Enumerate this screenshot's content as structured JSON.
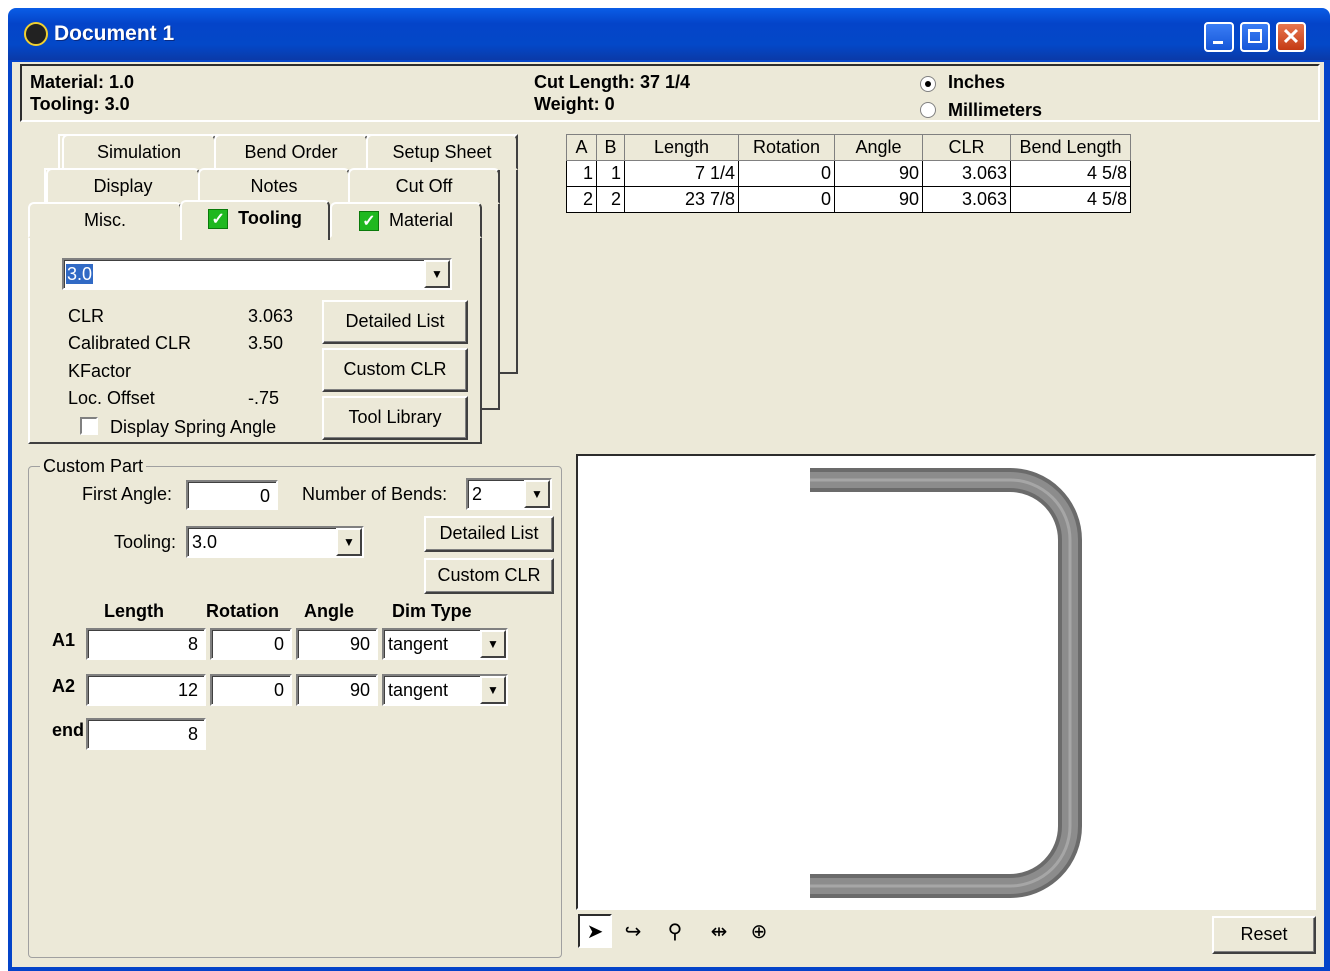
{
  "window": {
    "title": "Document 1"
  },
  "header": {
    "material": "Material: 1.0",
    "tooling": "Tooling: 3.0",
    "cut_length": "Cut Length: 37  1/4",
    "weight": "Weight: 0",
    "units": [
      {
        "label": "Inches",
        "selected": true
      },
      {
        "label": "Millimeters",
        "selected": false
      }
    ]
  },
  "tabs": {
    "row1": [
      "Simulation",
      "Bend Order",
      "Setup Sheet"
    ],
    "row2": [
      "Display",
      "Notes",
      "Cut Off"
    ],
    "row3": [
      "Misc.",
      "Tooling",
      "Material"
    ],
    "active": "Tooling"
  },
  "tooling_panel": {
    "select_value": "3.0",
    "clr_label": "CLR",
    "clr_value": "3.063",
    "cal_clr_label": "Calibrated CLR",
    "cal_clr_value": "3.50",
    "kfactor_label": "KFactor",
    "kfactor_value": "",
    "loc_offset_label": "Loc. Offset",
    "loc_offset_value": "-.75",
    "spring_label": "Display Spring Angle",
    "btn_detailed": "Detailed List",
    "btn_custom": "Custom CLR",
    "btn_library": "Tool Library"
  },
  "bend_table": {
    "headers": [
      "A",
      "B",
      "Length",
      "Rotation",
      "Angle",
      "CLR",
      "Bend Length"
    ],
    "rows": [
      [
        "1",
        "1",
        "7  1/4",
        "0",
        "90",
        "3.063",
        "4  5/8"
      ],
      [
        "2",
        "2",
        "23  7/8",
        "0",
        "90",
        "3.063",
        "4  5/8"
      ]
    ]
  },
  "custom_part": {
    "group_label": "Custom Part",
    "first_angle_label": "First Angle:",
    "first_angle_value": "0",
    "num_bends_label": "Number of Bends:",
    "num_bends_value": "2",
    "tooling_label": "Tooling:",
    "tooling_value": "3.0",
    "btn_detailed": "Detailed List",
    "btn_custom": "Custom CLR",
    "col_headers": [
      "Length",
      "Rotation",
      "Angle",
      "Dim Type"
    ],
    "rows": [
      {
        "label": "A1",
        "length": "8",
        "rotation": "0",
        "angle": "90",
        "dimtype": "tangent"
      },
      {
        "label": "A2",
        "length": "12",
        "rotation": "0",
        "angle": "90",
        "dimtype": "tangent"
      }
    ],
    "end_label": "end",
    "end_value": "8"
  },
  "viewport": {
    "tools": [
      "pointer-icon",
      "rotate-icon",
      "zoom-icon",
      "fit-width-icon",
      "pan-icon"
    ],
    "reset_label": "Reset"
  }
}
